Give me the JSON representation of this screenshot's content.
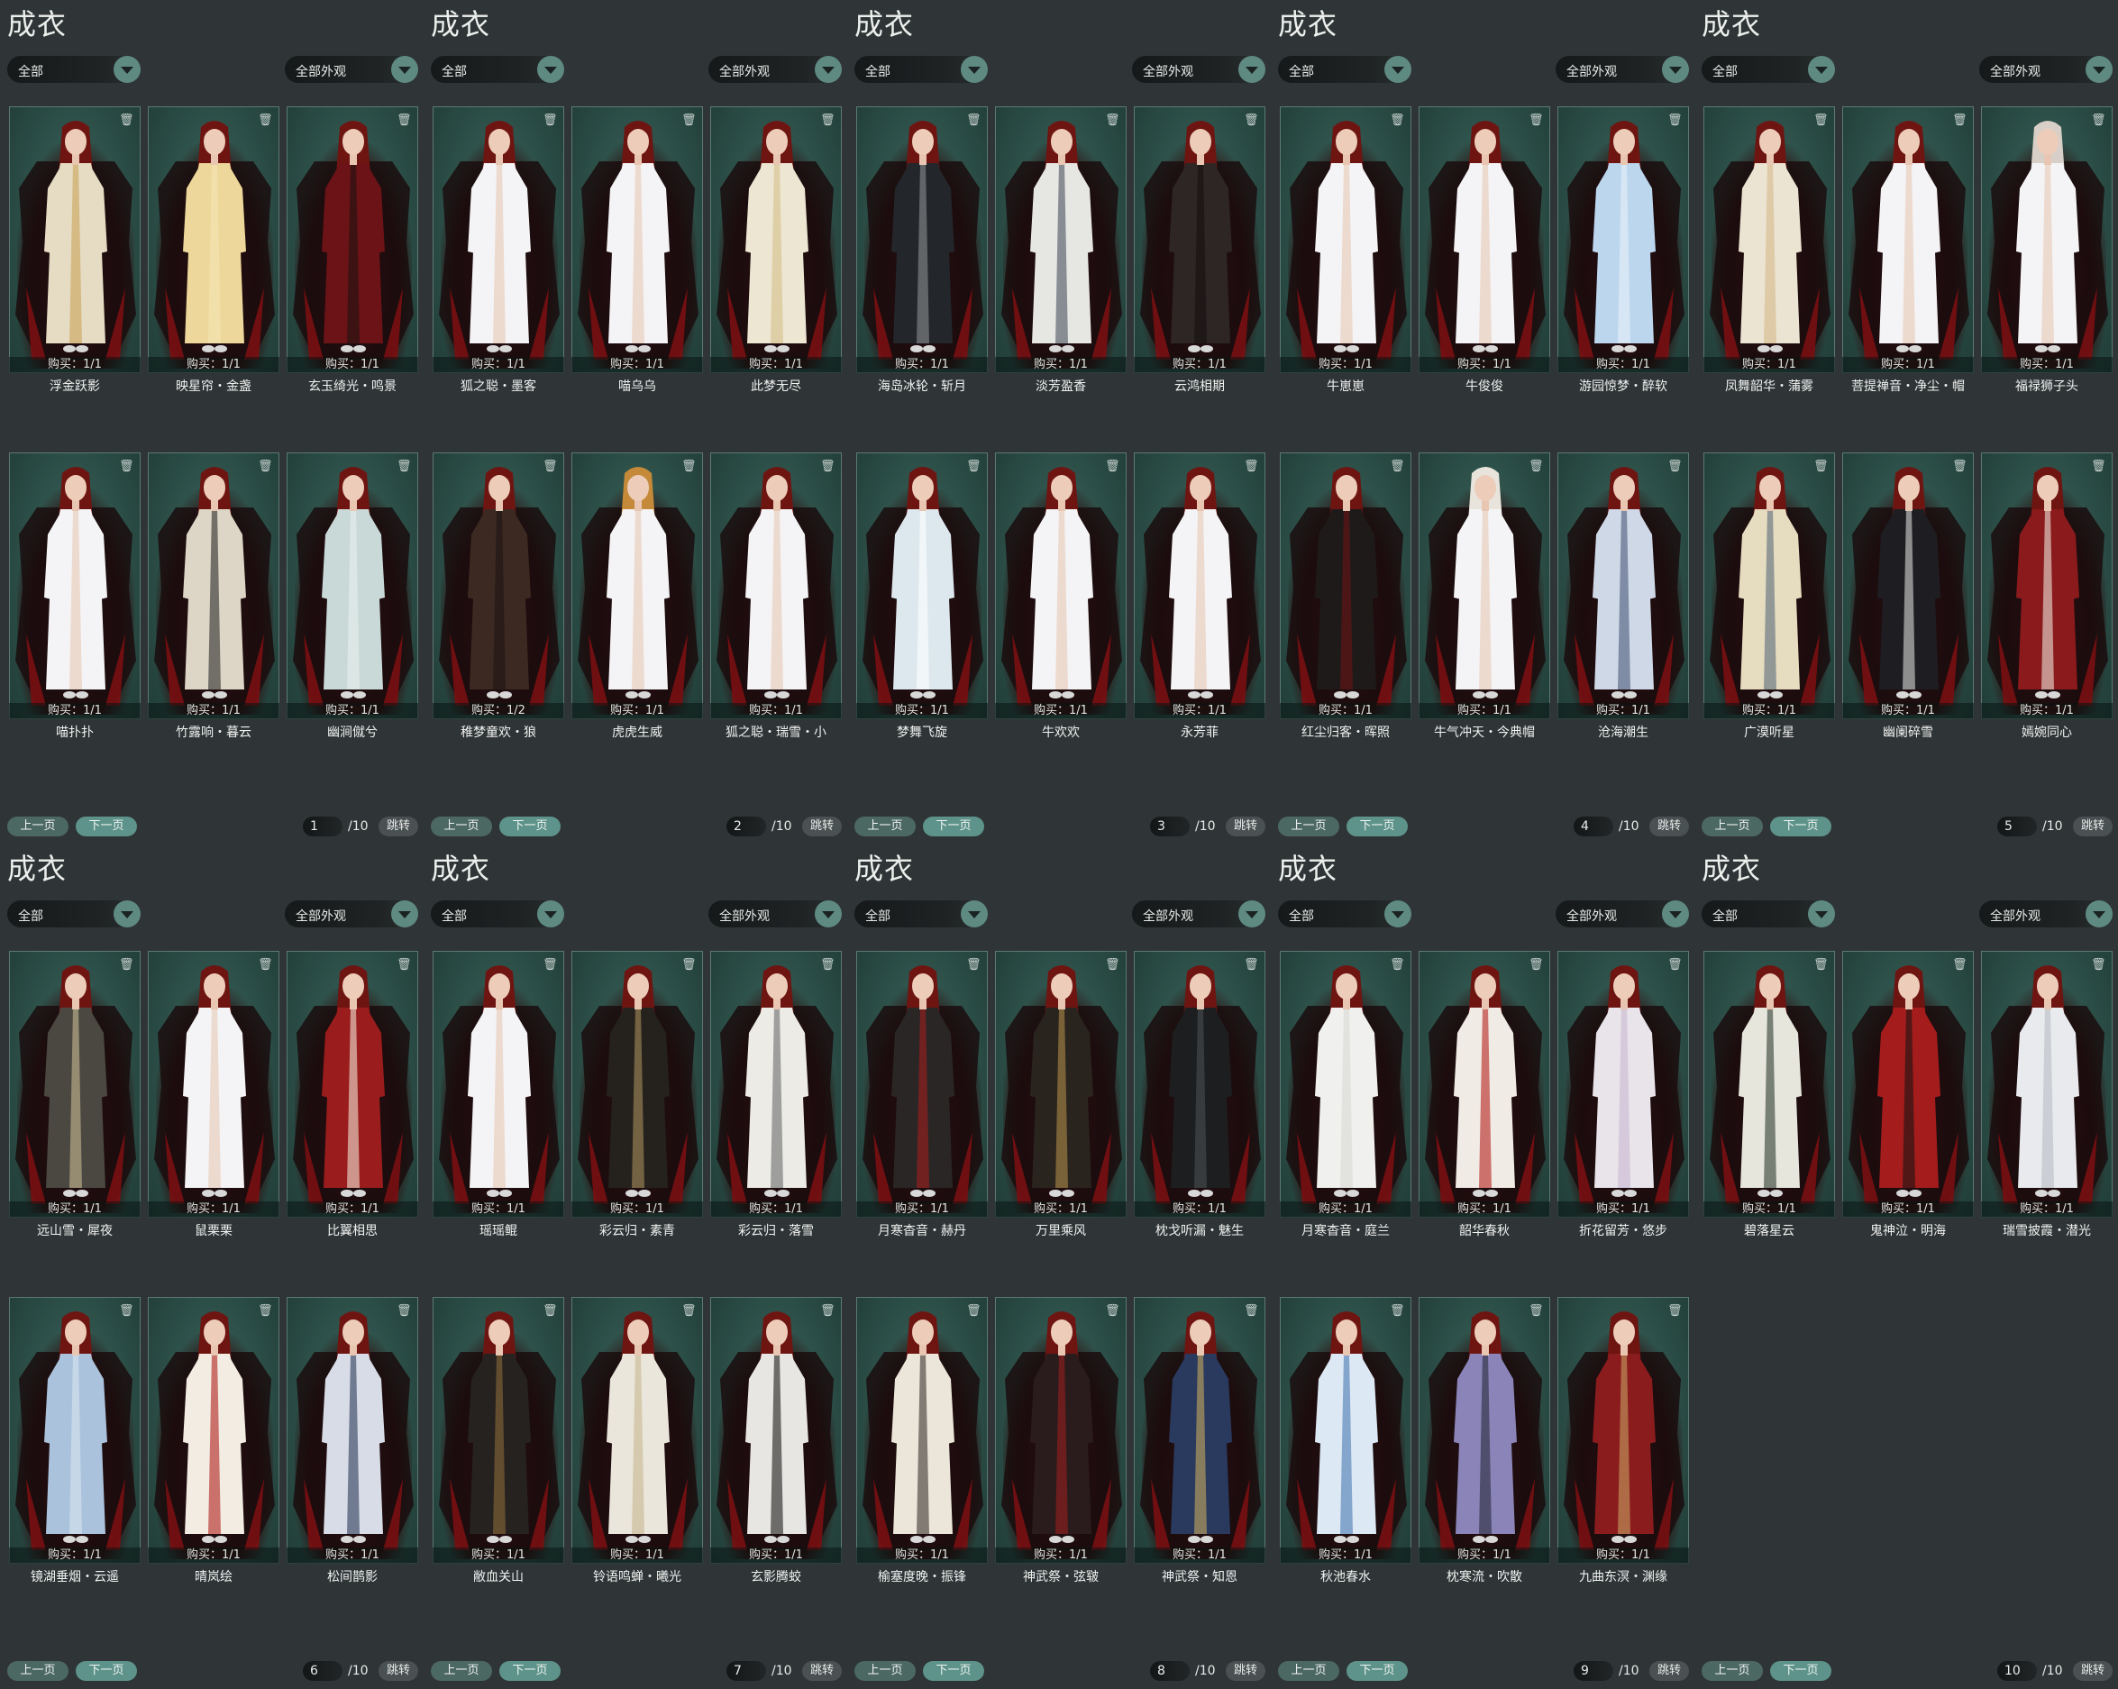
{
  "pages": [
    {
      "title": "成衣",
      "type_filter": "全部",
      "look_filter": "全部外观",
      "prev_label": "上一页",
      "next_label": "下一页",
      "page": "1",
      "total": "/10",
      "jump_label": "跳转",
      "items": [
        {
          "name": "浮金跃影",
          "buy": "购买：1/1",
          "hair_color": "#6e1512",
          "outfit_color": "#e6dcc4",
          "accent": "#c9a35a"
        },
        {
          "name": "映星帘・金盏",
          "buy": "购买：1/1",
          "hair_color": "#6e1512",
          "outfit_color": "#eed79a",
          "accent": "#f5e6b8"
        },
        {
          "name": "玄玉绮光・鸣景",
          "buy": "购买：1/1",
          "hair_color": "#6e1512",
          "outfit_color": "#6b1316",
          "accent": "#1c1212"
        },
        {
          "name": "喵扑扑",
          "buy": "购买：1/1",
          "hair_color": "#6e1512",
          "outfit_color": "#f4f4f6",
          "accent": "#e7c8b5"
        },
        {
          "name": "竹露响・暮云",
          "buy": "购买：1/1",
          "hair_color": "#6e1512",
          "outfit_color": "#ddd6c6",
          "accent": "#2a2a2a"
        },
        {
          "name": "幽涧僦兮",
          "buy": "购买：1/1",
          "hair_color": "#6e1512",
          "outfit_color": "#c9d9d8",
          "accent": "#e8eeee"
        }
      ]
    },
    {
      "title": "成衣",
      "type_filter": "全部",
      "look_filter": "全部外观",
      "prev_label": "上一页",
      "next_label": "下一页",
      "page": "2",
      "total": "/10",
      "jump_label": "跳转",
      "items": [
        {
          "name": "狐之聪・墨客",
          "buy": "购买：1/1",
          "hair_color": "#6e1512",
          "outfit_color": "#f4f4f6",
          "accent": "#e7c8b5"
        },
        {
          "name": "喵乌乌",
          "buy": "购买：1/1",
          "hair_color": "#6e1512",
          "outfit_color": "#f4f4f6",
          "accent": "#e7c8b5"
        },
        {
          "name": "此梦无尽",
          "buy": "购买：1/1",
          "hair_color": "#6e1512",
          "outfit_color": "#ede6d2",
          "accent": "#d4c08a"
        },
        {
          "name": "稚梦童欢・狼",
          "buy": "购买：1/2",
          "hair_color": "#6e1512",
          "outfit_color": "#3c2a22",
          "accent": "#1c1414"
        },
        {
          "name": "虎虎生威",
          "buy": "购买：1/1",
          "hair_color": "#c48a3a",
          "outfit_color": "#f4f4f6",
          "accent": "#e7c8b5"
        },
        {
          "name": "狐之聪・瑞雪・小",
          "buy": "购买：1/1",
          "hair_color": "#6e1512",
          "outfit_color": "#f4f4f6",
          "accent": "#e7c8b5"
        }
      ]
    },
    {
      "title": "成衣",
      "type_filter": "全部",
      "look_filter": "全部外观",
      "prev_label": "上一页",
      "next_label": "下一页",
      "page": "3",
      "total": "/10",
      "jump_label": "跳转",
      "items": [
        {
          "name": "海岛冰轮・斩月",
          "buy": "购买：1/1",
          "hair_color": "#6e1512",
          "outfit_color": "#23262a",
          "accent": "#8a8f92"
        },
        {
          "name": "淡芳盈香",
          "buy": "购买：1/1",
          "hair_color": "#6e1512",
          "outfit_color": "#e6e6e2",
          "accent": "#4a5260"
        },
        {
          "name": "云鸿相期",
          "buy": "购买：1/1",
          "hair_color": "#6e1512",
          "outfit_color": "#2e2624",
          "accent": "#141010"
        },
        {
          "name": "梦舞飞旋",
          "buy": "购买：1/1",
          "hair_color": "#6e1512",
          "outfit_color": "#dde8ee",
          "accent": "#ffffff"
        },
        {
          "name": "牛欢欢",
          "buy": "购买：1/1",
          "hair_color": "#6e1512",
          "outfit_color": "#f4f4f6",
          "accent": "#e7c8b5"
        },
        {
          "name": "永芳菲",
          "buy": "购买：1/1",
          "hair_color": "#6e1512",
          "outfit_color": "#f4f4f6",
          "accent": "#e7c8b5"
        }
      ]
    },
    {
      "title": "成衣",
      "type_filter": "全部",
      "look_filter": "全部外观",
      "prev_label": "上一页",
      "next_label": "下一页",
      "page": "4",
      "total": "/10",
      "jump_label": "跳转",
      "items": [
        {
          "name": "牛崽崽",
          "buy": "购买：1/1",
          "hair_color": "#6e1512",
          "outfit_color": "#f4f4f6",
          "accent": "#e7c8b5"
        },
        {
          "name": "牛俊俊",
          "buy": "购买：1/1",
          "hair_color": "#6e1512",
          "outfit_color": "#f4f4f6",
          "accent": "#e7c8b5"
        },
        {
          "name": "游园惊梦・醉软",
          "buy": "购买：1/1",
          "hair_color": "#6e1512",
          "outfit_color": "#bcd6ee",
          "accent": "#e8f0f8"
        },
        {
          "name": "红尘归客・晖照",
          "buy": "购买：1/1",
          "hair_color": "#6e1512",
          "outfit_color": "#1f1a1a",
          "accent": "#6a1416"
        },
        {
          "name": "牛气冲天・今典帽",
          "buy": "购买：1/1",
          "hair_color": "#e8e4dc",
          "outfit_color": "#f4f4f6",
          "accent": "#e7c8b5"
        },
        {
          "name": "沧海潮生",
          "buy": "购买：1/1",
          "hair_color": "#6e1512",
          "outfit_color": "#cfd8e6",
          "accent": "#4a5a7a"
        }
      ]
    },
    {
      "title": "成衣",
      "type_filter": "全部",
      "look_filter": "全部外观",
      "prev_label": "上一页",
      "next_label": "下一页",
      "page": "5",
      "total": "/10",
      "jump_label": "跳转",
      "items": [
        {
          "name": "凤舞韶华・蒲雾",
          "buy": "购买：1/1",
          "hair_color": "#6e1512",
          "outfit_color": "#ece4d2",
          "accent": "#d6b98a"
        },
        {
          "name": "菩提禅音・净尘・帽",
          "buy": "购买：1/1",
          "hair_color": "#6e1512",
          "outfit_color": "#f4f4f6",
          "accent": "#e7c8b5"
        },
        {
          "name": "福禄狮子头",
          "buy": "购买：1/1",
          "hair_color": "#d8d0c8",
          "outfit_color": "#f4f4f6",
          "accent": "#e7c8b5"
        },
        {
          "name": "广漠听星",
          "buy": "购买：1/1",
          "hair_color": "#6e1512",
          "outfit_color": "#e6dcc0",
          "accent": "#5a6a78"
        },
        {
          "name": "幽阑碎雪",
          "buy": "购买：1/1",
          "hair_color": "#6e1512",
          "outfit_color": "#1e1e22",
          "accent": "#d8d8d8"
        },
        {
          "name": "嫣婉同心",
          "buy": "购买：1/1",
          "hair_color": "#6e1512",
          "outfit_color": "#8a1a1c",
          "accent": "#ece6da"
        }
      ]
    },
    {
      "title": "成衣",
      "type_filter": "全部",
      "look_filter": "全部外观",
      "prev_label": "上一页",
      "next_label": "下一页",
      "page": "6",
      "total": "/10",
      "jump_label": "跳转",
      "items": [
        {
          "name": "远山雪・犀夜",
          "buy": "购买：1/1",
          "hair_color": "#6e1512",
          "outfit_color": "#4a4840",
          "accent": "#c8bb94"
        },
        {
          "name": "鼠栗栗",
          "buy": "购买：1/1",
          "hair_color": "#6e1512",
          "outfit_color": "#f4f4f6",
          "accent": "#e7c8b5"
        },
        {
          "name": "比翼相思",
          "buy": "购买：1/1",
          "hair_color": "#6e1512",
          "outfit_color": "#9a1c1c",
          "accent": "#f0e6d6"
        },
        {
          "name": "镜湖垂烟・云遥",
          "buy": "购买：1/1",
          "hair_color": "#6e1512",
          "outfit_color": "#aac2dc",
          "accent": "#d8e4f0"
        },
        {
          "name": "晴岚绘",
          "buy": "购买：1/1",
          "hair_color": "#6e1512",
          "outfit_color": "#f2ece2",
          "accent": "#b0201e"
        },
        {
          "name": "松间鹊影",
          "buy": "购买：1/1",
          "hair_color": "#6e1512",
          "outfit_color": "#d8dce6",
          "accent": "#2c3a5a"
        }
      ]
    },
    {
      "title": "成衣",
      "type_filter": "全部",
      "look_filter": "全部外观",
      "prev_label": "上一页",
      "next_label": "下一页",
      "page": "7",
      "total": "/10",
      "jump_label": "跳转",
      "items": [
        {
          "name": "瑶瑶鲲",
          "buy": "购买：1/1",
          "hair_color": "#6e1512",
          "outfit_color": "#f4f4f6",
          "accent": "#e7c8b5"
        },
        {
          "name": "彩云归・素青",
          "buy": "购买：1/1",
          "hair_color": "#6e1512",
          "outfit_color": "#25221e",
          "accent": "#a8905a"
        },
        {
          "name": "彩云归・落雪",
          "buy": "购买：1/1",
          "hair_color": "#6e1512",
          "outfit_color": "#ecebe6",
          "accent": "#6a6a6a"
        },
        {
          "name": "敝血关山",
          "buy": "购买：1/1",
          "hair_color": "#6e1512",
          "outfit_color": "#262220",
          "accent": "#8a6a3a"
        },
        {
          "name": "铃语鸣蝉・曦光",
          "buy": "购买：1/1",
          "hair_color": "#6e1512",
          "outfit_color": "#eae6dc",
          "accent": "#c8b890"
        },
        {
          "name": "玄影腾蛟",
          "buy": "购买：1/1",
          "hair_color": "#6e1512",
          "outfit_color": "#e8e6e2",
          "accent": "#1a1a1a"
        }
      ]
    },
    {
      "title": "成衣",
      "type_filter": "全部",
      "look_filter": "全部外观",
      "prev_label": "上一页",
      "next_label": "下一页",
      "page": "8",
      "total": "/10",
      "jump_label": "跳转",
      "items": [
        {
          "name": "月寒杳音・赫丹",
          "buy": "购买：1/1",
          "hair_color": "#6e1512",
          "outfit_color": "#2a2626",
          "accent": "#a41e1e"
        },
        {
          "name": "万里乘风",
          "buy": "购买：1/1",
          "hair_color": "#6e1512",
          "outfit_color": "#2a241e",
          "accent": "#b08c4a"
        },
        {
          "name": "枕戈听漏・魅生",
          "buy": "购买：1/1",
          "hair_color": "#6e1512",
          "outfit_color": "#1c1e20",
          "accent": "#4a4e52"
        },
        {
          "name": "榆塞度晚・振锋",
          "buy": "购买：1/1",
          "hair_color": "#6e1512",
          "outfit_color": "#ece6da",
          "accent": "#3a3430"
        },
        {
          "name": "神武祭・弦皲",
          "buy": "购买：1/1",
          "hair_color": "#6e1512",
          "outfit_color": "#2a1c1c",
          "accent": "#9a1e1e"
        },
        {
          "name": "神武祭・知恩",
          "buy": "购买：1/1",
          "hair_color": "#6e1512",
          "outfit_color": "#2a3a5e",
          "accent": "#c8a860"
        }
      ]
    },
    {
      "title": "成衣",
      "type_filter": "全部",
      "look_filter": "全部外观",
      "prev_label": "上一页",
      "next_label": "下一页",
      "page": "9",
      "total": "/10",
      "jump_label": "跳转",
      "items": [
        {
          "name": "月寒杳音・庭兰",
          "buy": "购买：1/1",
          "hair_color": "#6e1512",
          "outfit_color": "#f0f0ee",
          "accent": "#d8d8d4"
        },
        {
          "name": "韶华春秋",
          "buy": "购买：1/1",
          "hair_color": "#6e1512",
          "outfit_color": "#f0ebe4",
          "accent": "#b51f1d"
        },
        {
          "name": "折花留芳・悠步",
          "buy": "购买：1/1",
          "hair_color": "#6e1512",
          "outfit_color": "#e8e4ea",
          "accent": "#c8b8d0"
        },
        {
          "name": "秋池春水",
          "buy": "购买：1/1",
          "hair_color": "#6e1512",
          "outfit_color": "#dce8f4",
          "accent": "#4a78b0"
        },
        {
          "name": "枕寒流・吹散",
          "buy": "购买：1/1",
          "hair_color": "#6e1512",
          "outfit_color": "#8a84b8",
          "accent": "#2a2a3a"
        },
        {
          "name": "九曲东溟・渊缘",
          "buy": "购买：1/1",
          "hair_color": "#6e1512",
          "outfit_color": "#8a1c1e",
          "accent": "#c8a060"
        }
      ]
    },
    {
      "title": "成衣",
      "type_filter": "全部",
      "look_filter": "全部外观",
      "prev_label": "上一页",
      "next_label": "下一页",
      "page": "10",
      "total": "/10",
      "jump_label": "跳转",
      "items": [
        {
          "name": "碧落星云",
          "buy": "购买：1/1",
          "hair_color": "#6e1512",
          "outfit_color": "#e6e6dc",
          "accent": "#2e3a2e"
        },
        {
          "name": "鬼神泣・明海",
          "buy": "购买：1/1",
          "hair_color": "#6e1512",
          "outfit_color": "#a41c1c",
          "accent": "#1a1414"
        },
        {
          "name": "瑞雪披霞・潜光",
          "buy": "购买：1/1",
          "hair_color": "#6e1512",
          "outfit_color": "#e8eaee",
          "accent": "#b8bcc4"
        }
      ]
    }
  ]
}
